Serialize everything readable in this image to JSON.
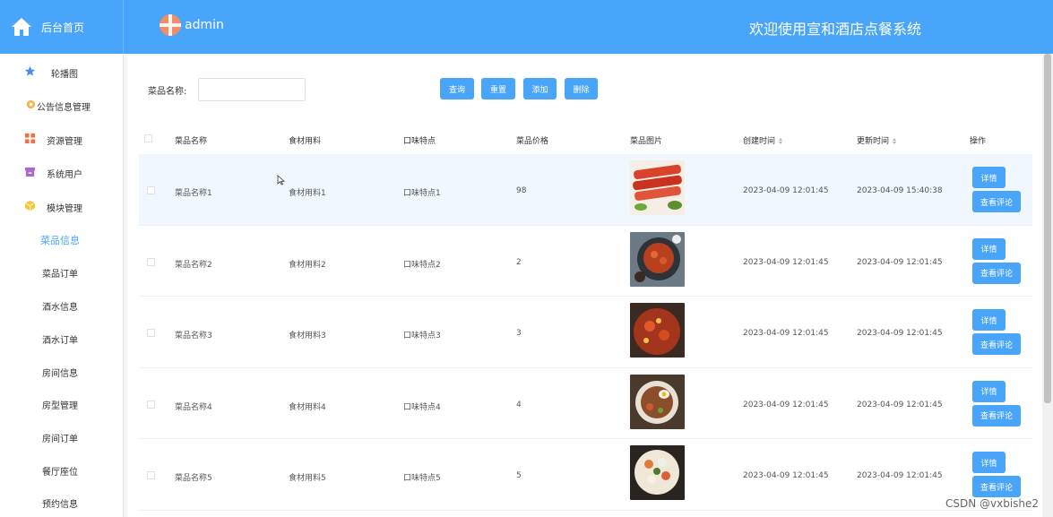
{
  "header": {
    "home_label": "后台首页",
    "username": "admin",
    "site_title": "欢迎使用宣和酒店点餐系统",
    "brand_color": "#48a5f9"
  },
  "sidebar": {
    "items": [
      {
        "label": "轮播图",
        "icon": "star-icon"
      },
      {
        "label": "公告信息管理",
        "icon": "gear-icon"
      },
      {
        "label": "资源管理",
        "icon": "grid-icon"
      },
      {
        "label": "系统用户",
        "icon": "box-icon"
      },
      {
        "label": "模块管理",
        "icon": "cube-icon"
      }
    ],
    "sub_items": [
      "菜品信息",
      "菜品订单",
      "酒水信息",
      "酒水订单",
      "房间信息",
      "房型管理",
      "房间订单",
      "餐厅座位",
      "预约信息"
    ],
    "active_sub": "菜品信息"
  },
  "search": {
    "label": "菜品名称:",
    "value": "",
    "placeholder": ""
  },
  "toolbar": {
    "query_label": "查询",
    "reset_label": "重置",
    "add_label": "添加",
    "delete_label": "删除"
  },
  "table": {
    "headers": [
      "菜品名称",
      "食材用料",
      "口味特点",
      "菜品价格",
      "菜品图片",
      "创建时间",
      "更新时间",
      "操作"
    ],
    "detail_label": "详情",
    "review_label": "查看评论",
    "rows": [
      {
        "name": "菜品名称1",
        "ingredients": "食材用料1",
        "flavor": "口味特点1",
        "price": "98",
        "created": "2023-04-09 12:01:45",
        "updated": "2023-04-09 15:40:38",
        "image": "dish-photo-1"
      },
      {
        "name": "菜品名称2",
        "ingredients": "食材用料2",
        "flavor": "口味特点2",
        "price": "2",
        "created": "2023-04-09 12:01:45",
        "updated": "2023-04-09 12:01:45",
        "image": "dish-photo-2"
      },
      {
        "name": "菜品名称3",
        "ingredients": "食材用料3",
        "flavor": "口味特点3",
        "price": "3",
        "created": "2023-04-09 12:01:45",
        "updated": "2023-04-09 12:01:45",
        "image": "dish-photo-3"
      },
      {
        "name": "菜品名称4",
        "ingredients": "食材用料4",
        "flavor": "口味特点4",
        "price": "4",
        "created": "2023-04-09 12:01:45",
        "updated": "2023-04-09 12:01:45",
        "image": "dish-photo-4"
      },
      {
        "name": "菜品名称5",
        "ingredients": "食材用料5",
        "flavor": "口味特点5",
        "price": "5",
        "created": "2023-04-09 12:01:45",
        "updated": "2023-04-09 12:01:45",
        "image": "dish-photo-5"
      }
    ]
  },
  "watermark": "CSDN @vxbishe2"
}
